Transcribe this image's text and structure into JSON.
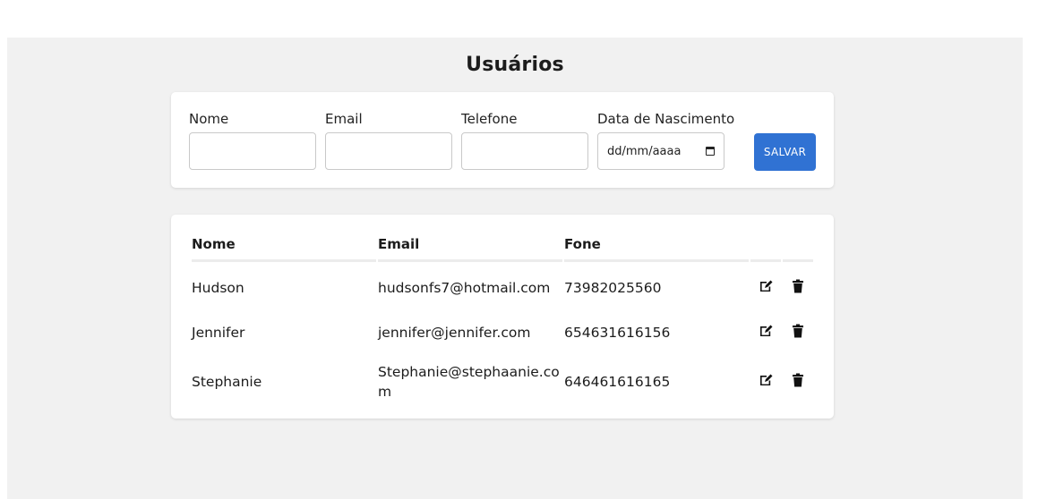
{
  "title": "Usuários",
  "form": {
    "fields": [
      {
        "label": "Nome",
        "value": ""
      },
      {
        "label": "Email",
        "value": ""
      },
      {
        "label": "Telefone",
        "value": ""
      },
      {
        "label": "Data de Nascimento",
        "value": "dd/mm/aaaa"
      }
    ],
    "save_label": "SALVAR"
  },
  "table": {
    "headers": [
      "Nome",
      "Email",
      "Fone"
    ],
    "rows": [
      {
        "nome": "Hudson",
        "email": "hudsonfs7@hotmail.com",
        "fone": "73982025560"
      },
      {
        "nome": "Jennifer",
        "email": "jennifer@jennifer.com",
        "fone": "654631616156"
      },
      {
        "nome": "Stephanie",
        "email": "Stephanie@stephaanie.com",
        "fone": "646461616165"
      }
    ]
  },
  "icons": {
    "edit": "edit-icon",
    "delete": "trash-icon"
  },
  "colors": {
    "accent": "#3072d3",
    "background": "#f1f1f1"
  }
}
